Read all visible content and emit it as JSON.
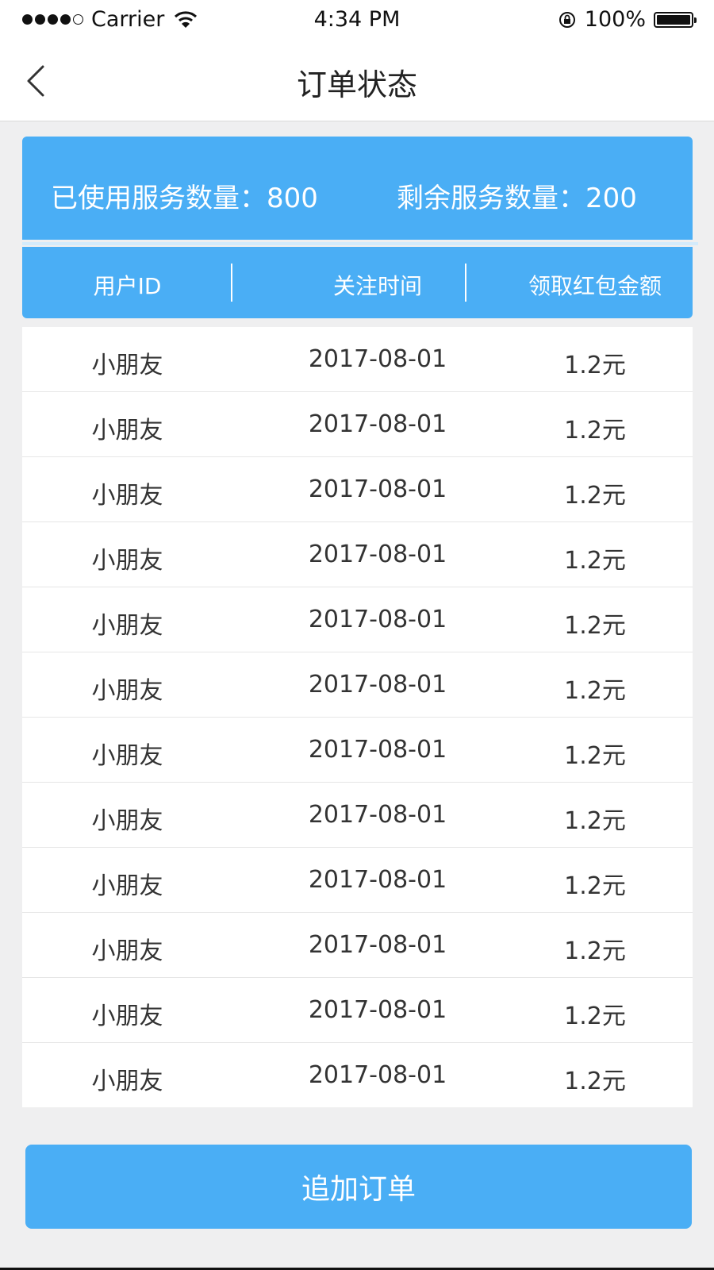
{
  "status_bar": {
    "carrier": "Carrier",
    "time": "4:34 PM",
    "battery": "100%"
  },
  "nav": {
    "title": "订单状态"
  },
  "summary": {
    "used_label": "已使用服务数量：800",
    "remain_label": "剩余服务数量：200"
  },
  "table": {
    "headers": [
      "用户ID",
      "关注时间",
      "领取红包金额"
    ],
    "rows": [
      [
        "小朋友",
        "2017-08-01",
        "1.2元"
      ],
      [
        "小朋友",
        "2017-08-01",
        "1.2元"
      ],
      [
        "小朋友",
        "2017-08-01",
        "1.2元"
      ],
      [
        "小朋友",
        "2017-08-01",
        "1.2元"
      ],
      [
        "小朋友",
        "2017-08-01",
        "1.2元"
      ],
      [
        "小朋友",
        "2017-08-01",
        "1.2元"
      ],
      [
        "小朋友",
        "2017-08-01",
        "1.2元"
      ],
      [
        "小朋友",
        "2017-08-01",
        "1.2元"
      ],
      [
        "小朋友",
        "2017-08-01",
        "1.2元"
      ],
      [
        "小朋友",
        "2017-08-01",
        "1.2元"
      ],
      [
        "小朋友",
        "2017-08-01",
        "1.2元"
      ],
      [
        "小朋友",
        "2017-08-01",
        "1.2元"
      ]
    ]
  },
  "footer": {
    "add_order_label": "追加订单"
  },
  "colors": {
    "accent": "#4aaef5",
    "background": "#efeff0"
  },
  "icons": {
    "back": "chevron-left-icon",
    "wifi": "wifi-icon",
    "rotation_lock": "rotation-lock-icon",
    "battery": "battery-icon"
  }
}
